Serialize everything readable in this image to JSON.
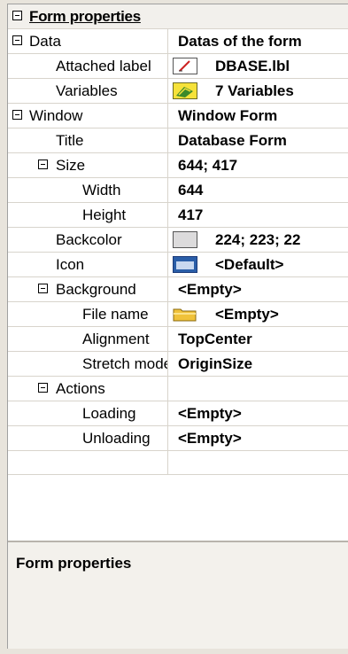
{
  "header": {
    "title": "Form properties"
  },
  "rows": [
    {
      "name": "Data",
      "value": "Datas of the form"
    },
    {
      "name": "Attached label",
      "value": "DBASE.lbl",
      "icon": "label-file-icon"
    },
    {
      "name": "Variables",
      "value": "7 Variables",
      "icon": "variables-icon"
    },
    {
      "name": "Window",
      "value": "Window Form"
    },
    {
      "name": "Title",
      "value": "Database Form"
    },
    {
      "name": "Size",
      "value": "644; 417"
    },
    {
      "name": "Width",
      "value": "644"
    },
    {
      "name": "Height",
      "value": "417"
    },
    {
      "name": "Backcolor",
      "value": "224; 223; 22",
      "icon": "color-swatch-icon"
    },
    {
      "name": "Icon",
      "value": "<Default>",
      "icon": "form-icon"
    },
    {
      "name": "Background",
      "value": "<Empty>"
    },
    {
      "name": "File name",
      "value": "<Empty>",
      "icon": "folder-icon"
    },
    {
      "name": "Alignment",
      "value": "TopCenter"
    },
    {
      "name": "Stretch mode",
      "value": "OriginSize"
    },
    {
      "name": "Actions",
      "value": ""
    },
    {
      "name": "Loading",
      "value": "<Empty>"
    },
    {
      "name": "Unloading",
      "value": "<Empty>"
    }
  ],
  "description": {
    "title": "Form properties"
  },
  "colors": {
    "backcolor_swatch": "#e0dfdc",
    "grid_line": "#d8d4cc"
  }
}
